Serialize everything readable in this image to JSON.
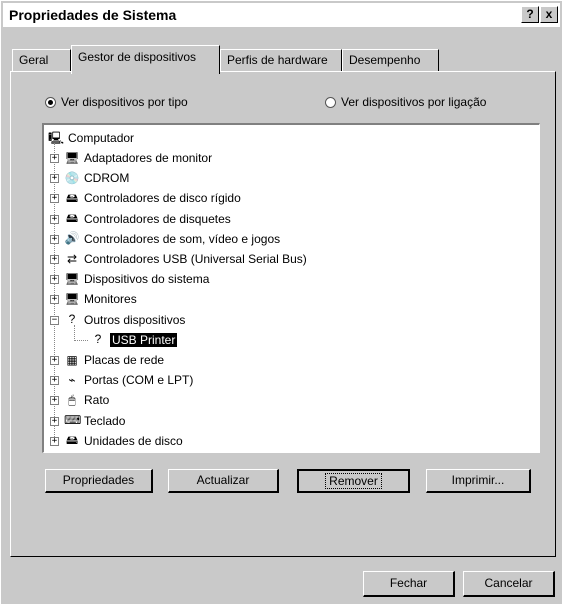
{
  "window": {
    "title": "Propriedades de Sistema",
    "help_label": "?",
    "close_label": "x"
  },
  "tabs": [
    {
      "label": "Geral",
      "active": false
    },
    {
      "label": "Gestor de dispositivos",
      "active": true
    },
    {
      "label": "Perfis de hardware",
      "active": false
    },
    {
      "label": "Desempenho",
      "active": false
    }
  ],
  "view_options": {
    "by_type_label": "Ver dispositivos por tipo",
    "by_type_selected": true,
    "by_connection_label": "Ver dispositivos por ligação",
    "by_connection_selected": false
  },
  "tree": {
    "root": "Computador",
    "items": [
      {
        "label": "Adaptadores de monitor",
        "expander": "+",
        "icon": "monitor-icon",
        "glyph": "🖥"
      },
      {
        "label": "CDROM",
        "expander": "+",
        "icon": "cdrom-icon",
        "glyph": "💿"
      },
      {
        "label": "Controladores de disco rígido",
        "expander": "+",
        "icon": "disk-controller-icon",
        "glyph": "🖴"
      },
      {
        "label": "Controladores de disquetes",
        "expander": "+",
        "icon": "floppy-controller-icon",
        "glyph": "🖴"
      },
      {
        "label": "Controladores de som, vídeo e jogos",
        "expander": "+",
        "icon": "sound-icon",
        "glyph": "🔊"
      },
      {
        "label": "Controladores USB (Universal Serial Bus)",
        "expander": "+",
        "icon": "usb-icon",
        "glyph": "⇄"
      },
      {
        "label": "Dispositivos do sistema",
        "expander": "+",
        "icon": "system-device-icon",
        "glyph": "🖥"
      },
      {
        "label": "Monitores",
        "expander": "+",
        "icon": "monitor-icon",
        "glyph": "🖥"
      },
      {
        "label": "Outros dispositivos",
        "expander": "-",
        "icon": "question-device-icon",
        "glyph": "?"
      },
      {
        "label": "Placas de rede",
        "expander": "+",
        "icon": "network-card-icon",
        "glyph": "▦"
      },
      {
        "label": "Portas (COM e LPT)",
        "expander": "+",
        "icon": "port-icon",
        "glyph": "⌁"
      },
      {
        "label": "Rato",
        "expander": "+",
        "icon": "mouse-icon",
        "glyph": "🖱"
      },
      {
        "label": "Teclado",
        "expander": "+",
        "icon": "keyboard-icon",
        "glyph": "⌨"
      },
      {
        "label": "Unidades de disco",
        "expander": "+",
        "icon": "disk-drive-icon",
        "glyph": "🖴"
      }
    ],
    "child_of_outros": {
      "label": "USB Printer",
      "icon": "unknown-device-icon",
      "glyph": "?",
      "selected": true
    }
  },
  "buttons": {
    "properties": "Propriedades",
    "refresh": "Actualizar",
    "remove": "Remover",
    "print": "Imprimir...",
    "close": "Fechar",
    "cancel": "Cancelar"
  },
  "colors": {
    "face": "#c9c9c9",
    "selection": "#000000"
  }
}
